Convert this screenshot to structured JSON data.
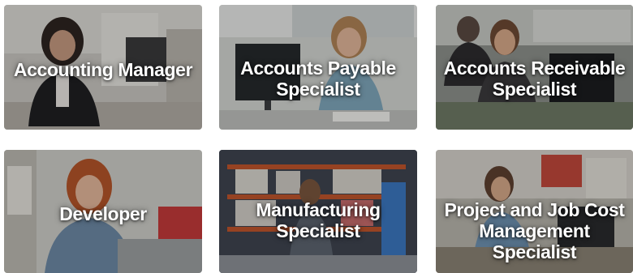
{
  "cards": [
    {
      "title": "Accounting Manager"
    },
    {
      "title": "Accounts Payable\nSpecialist"
    },
    {
      "title": "Accounts Receivable\nSpecialist"
    },
    {
      "title": "Developer"
    },
    {
      "title": "Manufacturing\nSpecialist"
    },
    {
      "title": "Project and Job Cost\nManagement\nSpecialist"
    }
  ]
}
